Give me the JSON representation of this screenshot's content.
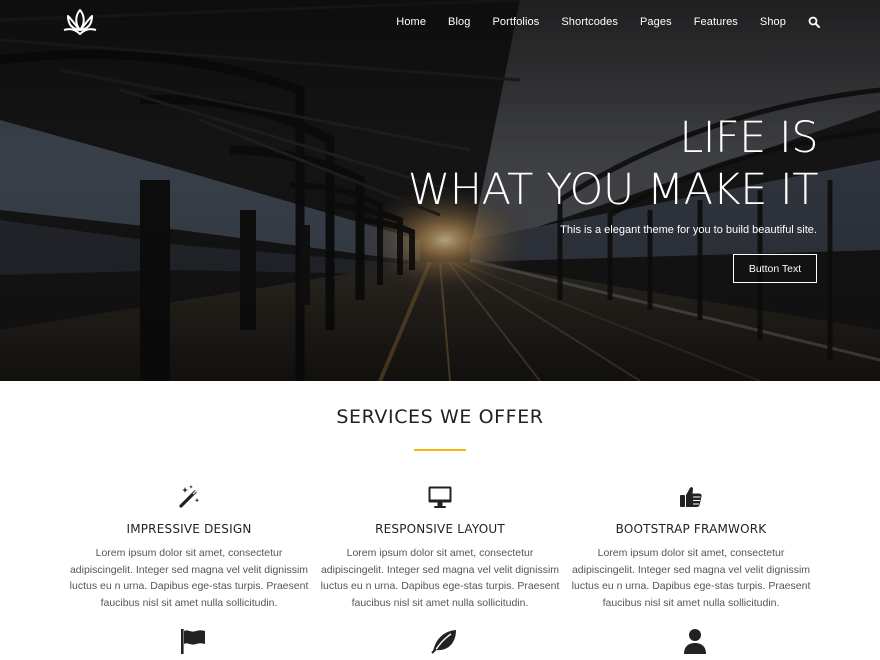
{
  "nav": {
    "items": [
      "Home",
      "Blog",
      "Portfolios",
      "Shortcodes",
      "Pages",
      "Features",
      "Shop"
    ],
    "search_icon": "search-icon"
  },
  "logo": {
    "icon": "lotus-icon"
  },
  "hero": {
    "title_line1": "LIFE IS",
    "title_line2": "WHAT YOU MAKE IT",
    "subtitle": "This is a elegant theme for you to build beautiful site.",
    "button_label": "Button Text"
  },
  "services": {
    "title": "SERVICES WE OFFER",
    "accent_color": "#f4b70f",
    "items": [
      {
        "icon": "magic-wand-icon",
        "title": "IMPRESSIVE DESIGN",
        "text_lines": [
          "Lorem ipsum dolor sit amet, consectetur",
          "adipiscingelit. Integer sed magna vel velit dignissim",
          "luctus eu n urna. Dapibus ege-stas turpis. Praesent",
          "faucibus nisl sit amet nulla sollicitudin."
        ]
      },
      {
        "icon": "desktop-icon",
        "title": "RESPONSIVE LAYOUT",
        "text_lines": [
          "Lorem ipsum dolor sit amet, consectetur",
          "adipiscingelit. Integer sed magna vel velit dignissim",
          "luctus eu n urna. Dapibus ege-stas turpis. Praesent",
          "faucibus nisl sit amet nulla sollicitudin."
        ]
      },
      {
        "icon": "thumbs-up-icon",
        "title": "BOOTSTRAP FRAMWORK",
        "text_lines": [
          "Lorem ipsum dolor sit amet, consectetur",
          "adipiscingelit. Integer sed magna vel velit dignissim",
          "luctus eu n urna. Dapibus ege-stas turpis. Praesent",
          "faucibus nisl sit amet nulla sollicitudin."
        ]
      }
    ],
    "second_row_icons": [
      "flag-icon",
      "leaf-icon",
      "user-icon"
    ]
  }
}
